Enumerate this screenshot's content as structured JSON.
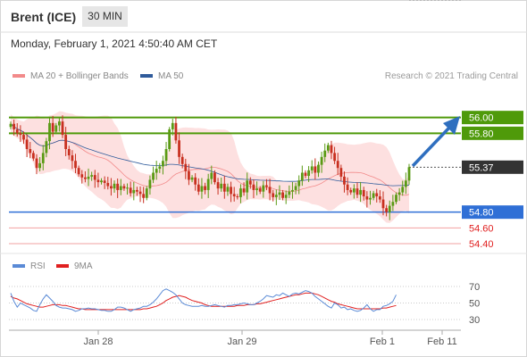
{
  "header": {
    "instrument": "Brent (ICE)",
    "timeframe": "30 MIN"
  },
  "datetime": "Monday, February 1, 2021 4:50:40 AM CET",
  "legend": {
    "ma20": {
      "label": "MA 20 + Bollinger Bands",
      "color": "#f28a8a"
    },
    "ma50": {
      "label": "MA 50",
      "color": "#2f5b9b"
    }
  },
  "research": "Research © 2021 Trading Central",
  "rsi_legend": {
    "rsi": {
      "label": "RSI",
      "color": "#5a8ad6"
    },
    "ma9": {
      "label": "9MA",
      "color": "#e02020"
    }
  },
  "levels": [
    {
      "value": "56.00",
      "kind": "resistance",
      "color": "#4f9a0a",
      "label_bg": "#4f9a0a",
      "label_fg": "#ffffff"
    },
    {
      "value": "55.80",
      "kind": "resistance",
      "color": "#4f9a0a",
      "label_bg": "#4f9a0a",
      "label_fg": "#ffffff"
    },
    {
      "value": "55.37",
      "kind": "last",
      "color": "#555555",
      "label_bg": "#333333",
      "label_fg": "#ffffff"
    },
    {
      "value": "54.80",
      "kind": "pivot",
      "color": "#2f6fd6",
      "label_bg": "#2f6fd6",
      "label_fg": "#ffffff"
    },
    {
      "value": "54.60",
      "kind": "support",
      "color": "#f2a0a0",
      "label_bg": "",
      "label_fg": "#e02020"
    },
    {
      "value": "54.40",
      "kind": "support",
      "color": "#f2a0a0",
      "label_bg": "",
      "label_fg": "#e02020"
    }
  ],
  "rsi_levels": [
    "70",
    "50",
    "30"
  ],
  "x_labels": [
    "Jan 28",
    "Jan 29",
    "Feb 1",
    "Feb 11"
  ],
  "colors": {
    "up": "#5a9a14",
    "down": "#c83020",
    "band": "#fde0e0",
    "arrow": "#2f6fbf"
  },
  "chart_data": {
    "type": "candlestick",
    "price_range": [
      54.4,
      56.2
    ],
    "last_price": 55.37,
    "closes": [
      55.92,
      55.85,
      55.8,
      55.78,
      55.72,
      55.6,
      55.55,
      55.48,
      55.36,
      55.42,
      55.55,
      55.7,
      55.93,
      55.82,
      55.9,
      55.95,
      55.78,
      55.6,
      55.52,
      55.45,
      55.36,
      55.28,
      55.24,
      55.22,
      55.25,
      55.27,
      55.21,
      55.18,
      55.2,
      55.17,
      55.13,
      55.1,
      55.16,
      55.08,
      55.13,
      55.1,
      55.11,
      55.04,
      55.08,
      55.06,
      55.03,
      54.98,
      55.1,
      55.21,
      55.3,
      55.35,
      55.38,
      55.45,
      55.6,
      55.85,
      55.93,
      55.71,
      55.5,
      55.41,
      55.32,
      55.21,
      55.24,
      55.15,
      55.06,
      55.13,
      55.08,
      55.22,
      55.3,
      55.18,
      55.1,
      55.16,
      55.06,
      55.12,
      55.03,
      55.0,
      54.99,
      55.1,
      55.05,
      55.2,
      55.15,
      55.08,
      55.1,
      55.06,
      55.14,
      55.12,
      55.04,
      54.99,
      55.02,
      55.05,
      54.98,
      55.02,
      55.06,
      55.08,
      55.13,
      55.2,
      55.3,
      55.26,
      55.33,
      55.38,
      55.3,
      55.4,
      55.5,
      55.58,
      55.65,
      55.55,
      55.45,
      55.36,
      55.25,
      55.15,
      55.08,
      55.05,
      55.1,
      55.02,
      55.08,
      55.0,
      54.96,
      54.98,
      55.04,
      55.0,
      54.96,
      54.85,
      54.8,
      54.88,
      54.93,
      55.02,
      55.05,
      55.12,
      55.2,
      55.37
    ],
    "rsi": [
      62,
      52,
      45,
      50,
      48,
      46,
      44,
      41,
      40,
      48,
      55,
      60,
      56,
      52,
      47,
      45,
      44,
      44,
      43,
      42,
      40,
      41,
      43,
      43,
      44,
      43,
      43,
      42,
      41,
      41,
      40,
      40,
      42,
      45,
      45,
      44,
      42,
      40,
      42,
      43,
      44,
      46,
      46,
      48,
      51,
      55,
      60,
      65,
      67,
      65,
      63,
      60,
      55,
      50,
      48,
      47,
      46,
      46,
      46,
      47,
      46,
      46,
      47,
      48,
      47,
      46,
      45,
      47,
      47,
      48,
      48,
      49,
      50,
      49,
      48,
      48,
      50,
      52,
      55,
      59,
      58,
      57,
      60,
      59,
      62,
      60,
      58,
      61,
      62,
      61,
      63,
      65,
      64,
      62,
      58,
      55,
      52,
      49,
      46,
      44,
      50,
      48,
      44,
      45,
      42,
      43,
      41,
      40,
      41,
      44,
      48,
      43,
      40,
      42,
      42,
      46,
      47,
      49,
      52,
      60
    ],
    "rsi_ma9": [
      58,
      56,
      55,
      53,
      51,
      49,
      48,
      47,
      46,
      45,
      45,
      46,
      47,
      48,
      48,
      48,
      47,
      47,
      46,
      45,
      44,
      43,
      43,
      42,
      42,
      42,
      42,
      42,
      42,
      42,
      42,
      42,
      42,
      42,
      42,
      42,
      42,
      42,
      42,
      42,
      42,
      43,
      43,
      44,
      45,
      46,
      48,
      50,
      53,
      55,
      57,
      58,
      59,
      58,
      57,
      55,
      53,
      52,
      51,
      50,
      48,
      47,
      46,
      46,
      46,
      46,
      46,
      46,
      46,
      46,
      47,
      47,
      47,
      48,
      48,
      48,
      49,
      49,
      50,
      51,
      52,
      53,
      54,
      55,
      56,
      57,
      58,
      59,
      60,
      60,
      61,
      62,
      62,
      62,
      61,
      60,
      58,
      56,
      54,
      52,
      51,
      49,
      48,
      47,
      46,
      45,
      44,
      43,
      43,
      43,
      43,
      43,
      43,
      43,
      43,
      44,
      44,
      45,
      46,
      47
    ]
  }
}
